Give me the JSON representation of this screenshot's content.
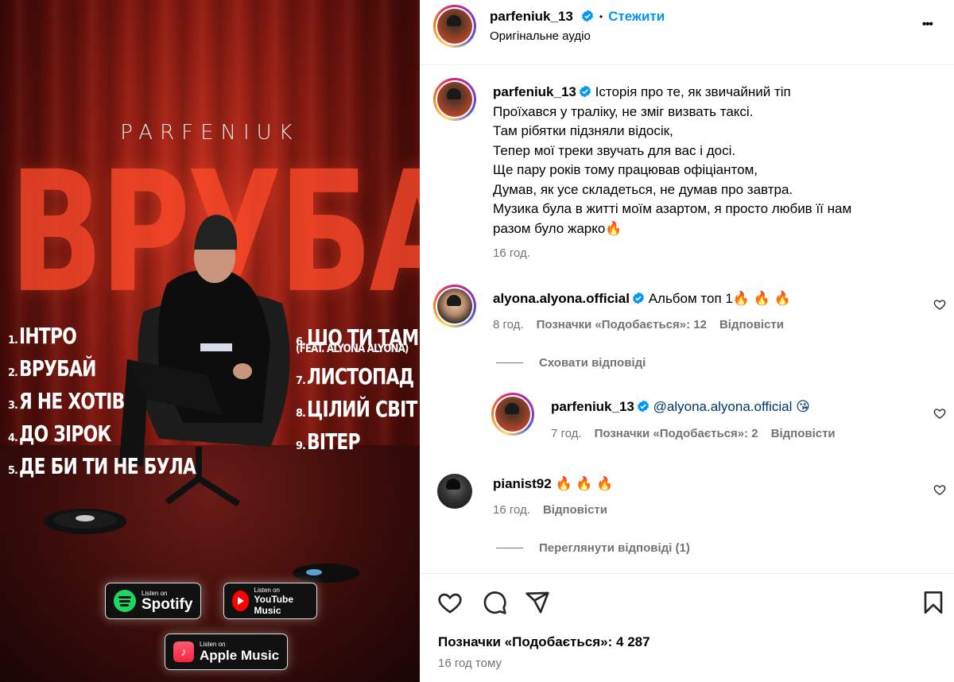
{
  "poster": {
    "artist": "PARFENIUK",
    "title": "ВРУБАЙ",
    "tracks_left": [
      {
        "num": "1.",
        "name": "ІНТРО"
      },
      {
        "num": "2.",
        "name": "ВРУБАЙ"
      },
      {
        "num": "3.",
        "name": "Я НЕ ХОТІВ"
      },
      {
        "num": "4.",
        "name": "ДО ЗІРОК"
      },
      {
        "num": "5.",
        "name": "ДЕ БИ ТИ НЕ БУЛА"
      }
    ],
    "tracks_right": [
      {
        "num": "6.",
        "name": "ШО ТИ ТАМ?"
      },
      {
        "num": "",
        "name": "(FEAT. ALYONA ALYONA)"
      },
      {
        "num": "7.",
        "name": "ЛИСТОПАД"
      },
      {
        "num": "8.",
        "name": "ЦІЛИЙ СВІТ"
      },
      {
        "num": "9.",
        "name": "ВІТЕР"
      }
    ],
    "buttons": {
      "spotify": {
        "small": "Listen on",
        "big": "Spotify"
      },
      "youtube": {
        "small": "Listen on",
        "big": "YouTube Music"
      },
      "apple": {
        "small": "Listen on",
        "big": "Apple Music"
      }
    }
  },
  "header": {
    "username": "parfeniuk_13",
    "separator": "•",
    "follow": "Стежити",
    "audio": "Оригінальне аудіо",
    "more": "•••"
  },
  "caption": {
    "username": "parfeniuk_13",
    "lines": [
      "Історія про те, як звичайний тіп",
      "Проїхався у траліку, не зміг визвать таксі.",
      "Там рібятки підзняли відосік,",
      "Тепер мої треки звучать для вас і досі.",
      "Ще пару років тому працював офіціантом,",
      "Думав, як усе складеться, не думав про завтра.",
      "Музика була в житті моїм азартом, я просто любив її нам",
      "разом було жарко🔥"
    ],
    "time": "16 год."
  },
  "comments": [
    {
      "username": "alyona.alyona.official",
      "text": "Альбом топ 1🔥 🔥 🔥",
      "time": "8 год.",
      "likes": "Позначки «Подобається»: 12",
      "reply": "Відповісти",
      "toggle": "Сховати відповіді"
    },
    {
      "username": "parfeniuk_13",
      "text": "@alyona.alyona.official 😘",
      "time": "7 год.",
      "likes": "Позначки «Подобається»: 2",
      "reply": "Відповісти"
    },
    {
      "username": "pianist92",
      "text": "🔥 🔥 🔥",
      "time": "16 год.",
      "reply": "Відповісти",
      "toggle": "Переглянути відповіді (1)"
    }
  ],
  "footer": {
    "likes": "Позначки «Подобається»: 4 287",
    "time": "16 год тому"
  },
  "colors": {
    "accent": "#0095f6",
    "muted": "#737373",
    "verified": "#0095f6"
  },
  "icons": [
    "heart-icon",
    "comment-icon",
    "share-icon",
    "bookmark-icon",
    "more-icon",
    "verified-icon"
  ]
}
